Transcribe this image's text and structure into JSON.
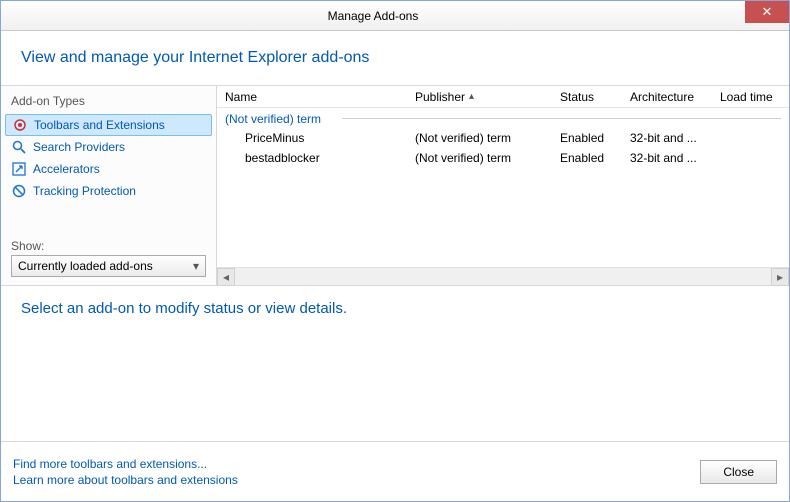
{
  "titlebar": {
    "title": "Manage Add-ons"
  },
  "header": {
    "text": "View and manage your Internet Explorer add-ons"
  },
  "sidebar": {
    "types_label": "Add-on Types",
    "items": [
      {
        "label": "Toolbars and Extensions"
      },
      {
        "label": "Search Providers"
      },
      {
        "label": "Accelerators"
      },
      {
        "label": "Tracking Protection"
      }
    ],
    "show_label": "Show:",
    "show_value": "Currently loaded add-ons"
  },
  "columns": {
    "name": "Name",
    "publisher": "Publisher",
    "status": "Status",
    "architecture": "Architecture",
    "load_time": "Load time"
  },
  "group": {
    "label": "(Not verified) term"
  },
  "rows": [
    {
      "name": "PriceMinus",
      "publisher": "(Not verified) term",
      "status": "Enabled",
      "architecture": "32-bit and ..."
    },
    {
      "name": "bestadblocker",
      "publisher": "(Not verified) term",
      "status": "Enabled",
      "architecture": "32-bit and ..."
    }
  ],
  "details": {
    "prompt": "Select an add-on to modify status or view details."
  },
  "footer": {
    "find_link": "Find more toolbars and extensions...",
    "learn_link": "Learn more about toolbars and extensions",
    "close_label": "Close"
  }
}
